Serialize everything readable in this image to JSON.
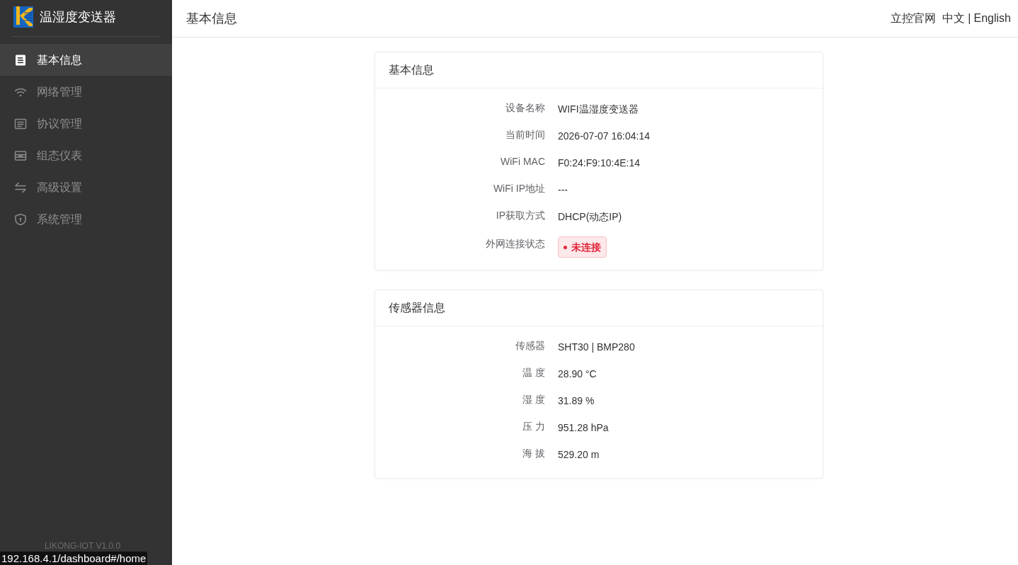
{
  "sidebar": {
    "title": "温湿度变送器",
    "items": [
      {
        "label": "基本信息",
        "selected": true
      },
      {
        "label": "网络管理",
        "selected": false
      },
      {
        "label": "协议管理",
        "selected": false
      },
      {
        "label": "组态仪表",
        "selected": false
      },
      {
        "label": "高级设置",
        "selected": false
      },
      {
        "label": "系统管理",
        "selected": false
      }
    ],
    "version": "LIKONG-IOT V1.0.0"
  },
  "header": {
    "title": "基本信息",
    "links": [
      "立控官网"
    ],
    "languages": [
      "中文",
      "English"
    ],
    "separator": "|"
  },
  "cards": [
    {
      "title": "基本信息",
      "rows": [
        {
          "kind": "text",
          "label": "设备名称",
          "value": "WIFI温湿度变送器"
        },
        {
          "kind": "text",
          "label": "当前时间",
          "value": "2026-07-07 16:04:14"
        },
        {
          "kind": "text",
          "label": "WiFi MAC",
          "value": "F0:24:F9:10:4E:14"
        },
        {
          "kind": "text",
          "label": "WiFi IP地址",
          "value": "---"
        },
        {
          "kind": "text",
          "label": "IP获取方式",
          "value": "DHCP(动态IP)"
        },
        {
          "kind": "badge",
          "label": "外网连接状态",
          "value": "未连接",
          "connected": false
        }
      ]
    },
    {
      "title": "传感器信息",
      "rows": [
        {
          "kind": "text",
          "label": "传感器",
          "value": "SHT30 | BMP280"
        },
        {
          "kind": "text",
          "label": "温 度",
          "value": "28.90 °C"
        },
        {
          "kind": "text",
          "label": "湿 度",
          "value": "31.89 %"
        },
        {
          "kind": "text",
          "label": "压 力",
          "value": "951.28 hPa"
        },
        {
          "kind": "text",
          "label": "海 拔",
          "value": "529.20 m"
        }
      ]
    }
  ],
  "browser_status": {
    "url": "192.168.4.1/dashboard#/home"
  }
}
